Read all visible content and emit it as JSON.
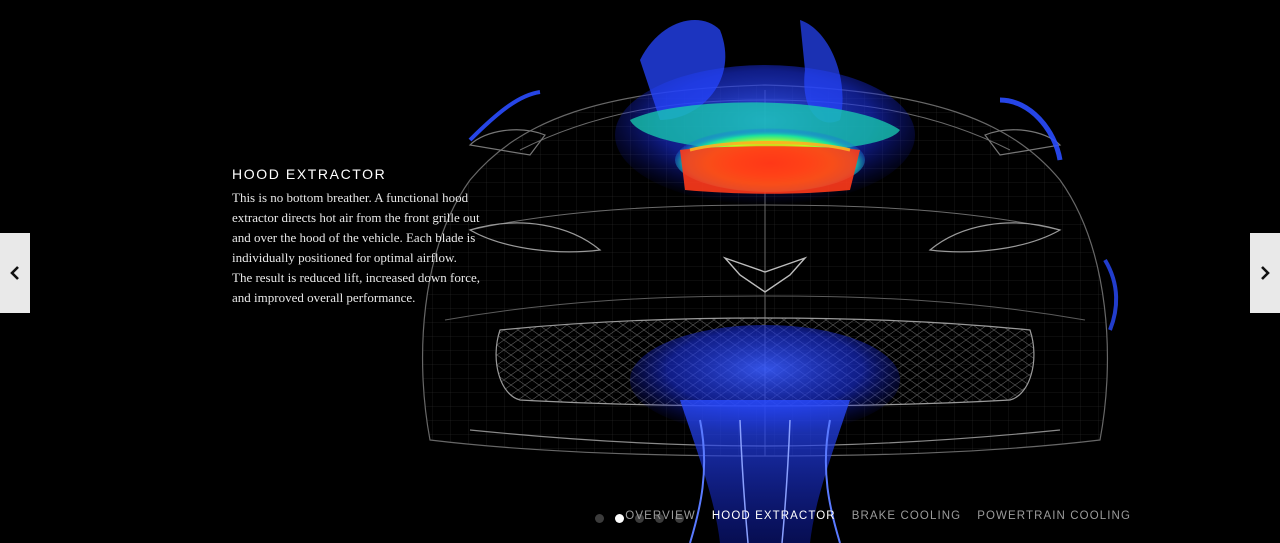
{
  "feature": {
    "title": "HOOD EXTRACTOR",
    "lines": [
      "This is no bottom breather. A functional hood",
      "extractor directs hot air from the front grille out",
      "and over the hood of the vehicle. Each blade is",
      "individually positioned for optimal airflow.",
      "The result is reduced lift, increased down force,",
      "and improved overall performance."
    ]
  },
  "navigation": {
    "prev_icon": "chevron-left-icon",
    "next_icon": "chevron-right-icon",
    "slide_count": 5,
    "active_slide": 2,
    "sections": [
      {
        "label": "OVERVIEW",
        "active": false
      },
      {
        "label": "HOOD EXTRACTOR",
        "active": true
      },
      {
        "label": "BRAKE COOLING",
        "active": false
      },
      {
        "label": "POWERTRAIN COOLING",
        "active": false
      }
    ]
  },
  "colors": {
    "background": "#000000",
    "airflow_cold": "#1e3cff",
    "airflow_mid": "#18e0a0",
    "airflow_hot": "#ff2a10",
    "wireframe": "#8a8a8a",
    "button_bg": "#e9e9e9"
  }
}
